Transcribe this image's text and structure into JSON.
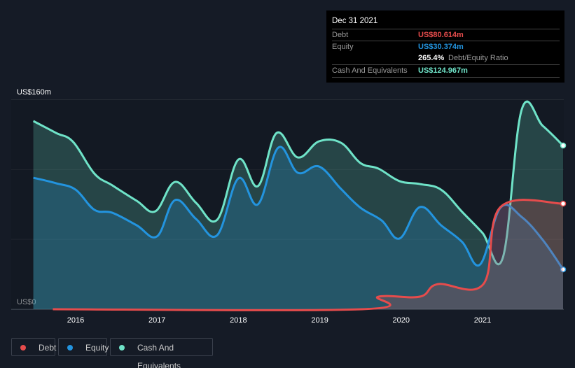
{
  "tooltip": {
    "date": "Dec 31 2021",
    "debt_label": "Debt",
    "debt_value": "US$80.614m",
    "equity_label": "Equity",
    "equity_value": "US$30.374m",
    "ratio_value": "265.4%",
    "ratio_label": "Debt/Equity Ratio",
    "cash_label": "Cash And Equivalents",
    "cash_value": "US$124.967m"
  },
  "legend": [
    {
      "label": "Debt",
      "color": "#e64c4c"
    },
    {
      "label": "Equity",
      "color": "#2394df"
    },
    {
      "label": "Cash And Equivalents",
      "color": "#6fe3c8"
    }
  ],
  "chart_data": {
    "type": "area",
    "ylabel_top": "US$160m",
    "ylabel_bottom": "US$0",
    "ylim": [
      0,
      160
    ],
    "xticks": [
      "2016",
      "2017",
      "2018",
      "2019",
      "2020",
      "2021"
    ],
    "xlim": [
      2015.48,
      2021.99
    ],
    "series": [
      {
        "name": "Cash And Equivalents",
        "color": "#6fe3c8",
        "points": [
          [
            2015.48,
            143.7
          ],
          [
            2015.76,
            134.6
          ],
          [
            2015.97,
            127.7
          ],
          [
            2016.23,
            103.6
          ],
          [
            2016.45,
            94.6
          ],
          [
            2016.75,
            82.8
          ],
          [
            2016.98,
            74.8
          ],
          [
            2017.22,
            97.2
          ],
          [
            2017.48,
            81.2
          ],
          [
            2017.74,
            68.4
          ],
          [
            2018.0,
            114.3
          ],
          [
            2018.24,
            94
          ],
          [
            2018.47,
            134.6
          ],
          [
            2018.73,
            115.9
          ],
          [
            2018.99,
            128.2
          ],
          [
            2019.26,
            127.1
          ],
          [
            2019.5,
            111.6
          ],
          [
            2019.72,
            107.4
          ],
          [
            2019.98,
            97.8
          ],
          [
            2020.23,
            95.6
          ],
          [
            2020.49,
            91.3
          ],
          [
            2020.75,
            74.3
          ],
          [
            2021.0,
            58.2
          ],
          [
            2021.25,
            39.5
          ],
          [
            2021.48,
            152.2
          ],
          [
            2021.74,
            140
          ],
          [
            2021.99,
            124.967
          ]
        ]
      },
      {
        "name": "Equity",
        "color": "#2394df",
        "points": [
          [
            2015.48,
            100.4
          ],
          [
            2015.76,
            96.2
          ],
          [
            2016.0,
            91.3
          ],
          [
            2016.23,
            75.9
          ],
          [
            2016.45,
            73.7
          ],
          [
            2016.75,
            64.1
          ],
          [
            2017.0,
            55.6
          ],
          [
            2017.22,
            83.3
          ],
          [
            2017.48,
            68.9
          ],
          [
            2017.74,
            56.6
          ],
          [
            2018.0,
            99.9
          ],
          [
            2018.24,
            80.1
          ],
          [
            2018.49,
            123.4
          ],
          [
            2018.73,
            104.2
          ],
          [
            2018.99,
            109
          ],
          [
            2019.26,
            91.9
          ],
          [
            2019.5,
            77.5
          ],
          [
            2019.76,
            67.8
          ],
          [
            2019.98,
            54
          ],
          [
            2020.23,
            78
          ],
          [
            2020.49,
            64.1
          ],
          [
            2020.75,
            51.3
          ],
          [
            2020.97,
            34.2
          ],
          [
            2021.22,
            77.5
          ],
          [
            2021.48,
            70.5
          ],
          [
            2021.74,
            52.9
          ],
          [
            2021.99,
            30.374
          ]
        ]
      },
      {
        "name": "Debt",
        "color": "#e64c4c",
        "points": [
          [
            2015.72,
            0
          ],
          [
            2019.52,
            0
          ],
          [
            2019.72,
            9.6
          ],
          [
            2020.23,
            9.6
          ],
          [
            2020.45,
            19.2
          ],
          [
            2021.01,
            19.2
          ],
          [
            2021.22,
            78
          ],
          [
            2021.99,
            80.614
          ]
        ]
      }
    ]
  }
}
